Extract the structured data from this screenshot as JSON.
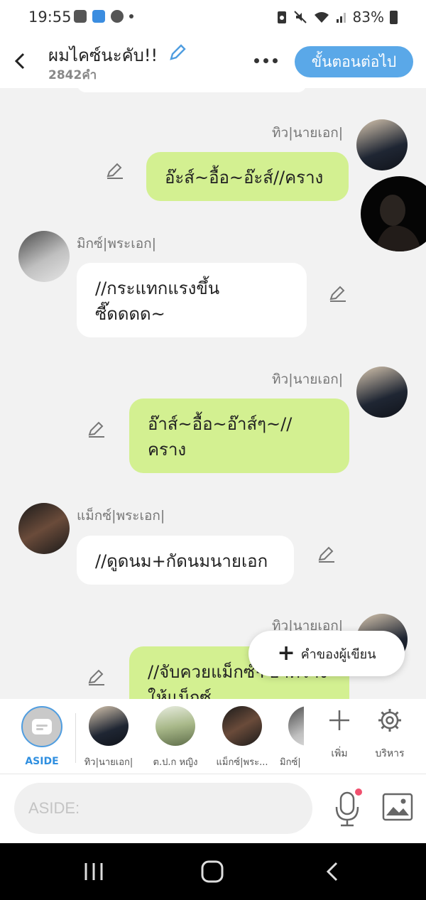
{
  "status_bar": {
    "time": "19:55",
    "battery": "83%",
    "icons": [
      "gallery-icon",
      "webtoon-icon",
      "line-icon",
      "notification-dot",
      "battery-saver-icon",
      "mute-icon",
      "wifi-icon",
      "signal-icon",
      "battery-icon"
    ]
  },
  "header": {
    "title": "ผมไคซ์นะคับ!!",
    "word_count": "2842คำ",
    "next_label": "ขั้นตอนต่อไป"
  },
  "messages": [
    {
      "side": "right",
      "speaker": "ทิว|นายเอก|",
      "text": "อ๊ะส์~อื้อ~อ๊ะส์//คราง"
    },
    {
      "side": "left",
      "speaker": "มิกซ์|พระเอก|",
      "text": "//กระแทกแรงขึ้น\nซี๊ดดดด~"
    },
    {
      "side": "right",
      "speaker": "ทิว|นายเอก|",
      "text": "อ๊าส์~อื้อ~อ๊าส์ๆ~//\nคราง"
    },
    {
      "side": "left",
      "speaker": "แม็กซ์|พระเอก|",
      "text": "//ดูดนม+กัดนมนายเอก"
    },
    {
      "side": "right",
      "speaker": "ทิว|นายเอก|",
      "text": "//จับควยแม็กซ์+อ๊าคราง\nให้แม็กซ์"
    }
  ],
  "fab": {
    "label": "คำของผู้เขียน"
  },
  "characters": [
    {
      "label": "ASIDE"
    },
    {
      "label": "ทิว|นายเอก|"
    },
    {
      "label": "ต.ป.ก หญิง"
    },
    {
      "label": "แม็กซ์|พระ..."
    },
    {
      "label": "มิกซ์|"
    }
  ],
  "tools": {
    "add_label": "เพิ่ม",
    "manage_label": "บริหาร"
  },
  "input": {
    "placeholder": "ASIDE:"
  },
  "colors": {
    "accent": "#5aa8e8",
    "bubble_green": "#d3f091",
    "aside_blue": "#2f8fe0"
  }
}
